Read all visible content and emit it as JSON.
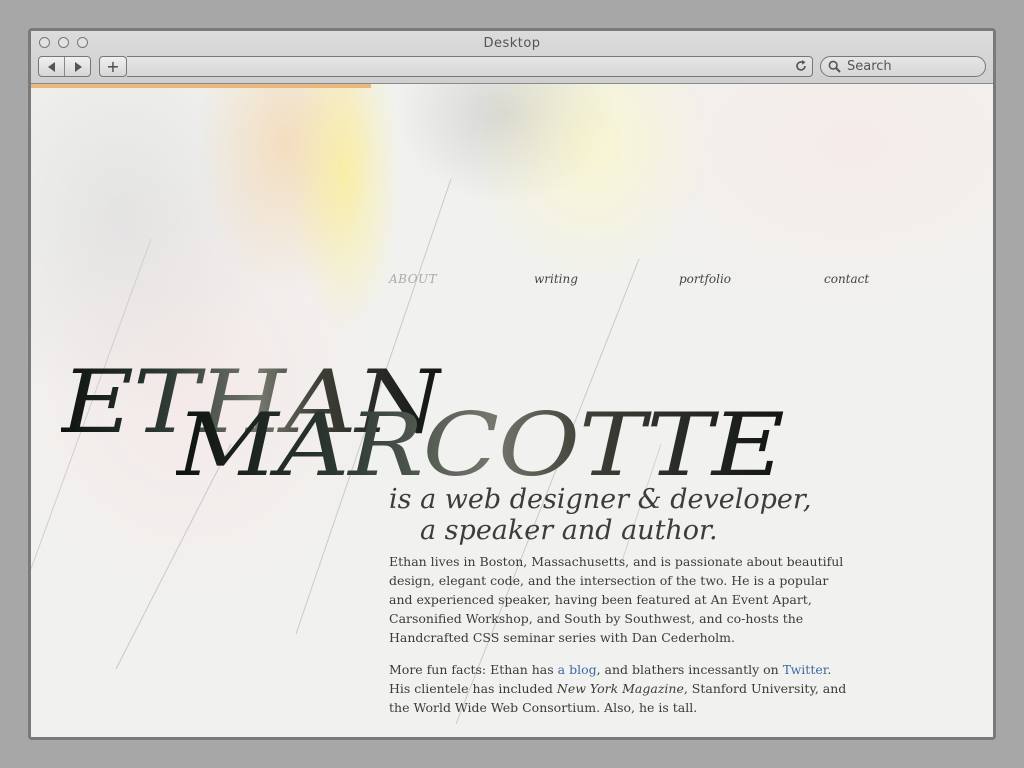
{
  "window": {
    "title": "Desktop",
    "search_placeholder": "Search",
    "nav_back_icon": "back-arrow-icon",
    "nav_forward_icon": "forward-arrow-icon",
    "new_tab_label": "+",
    "reload_icon": "reload-icon",
    "search_icon": "magnifier-icon"
  },
  "page": {
    "nav": [
      {
        "label": "ABOUT",
        "active": true
      },
      {
        "label": "writing",
        "active": false
      },
      {
        "label": "portfolio",
        "active": false
      },
      {
        "label": "contact",
        "active": false
      }
    ],
    "name_first": "ETHAN",
    "name_last": "MARCOTTE",
    "tagline_line1": "is a web designer",
    "tagline_amp": "&",
    "tagline_line1b": "developer,",
    "tagline_line2": "a speaker and author.",
    "bio": {
      "p1": "Ethan lives in Boston, Massachusetts, and is passionate about beautiful design, elegant code, and the intersection of the two. He is a popular and experienced speaker, having been featured at An Event Apart, Carsonified Workshop, and South by Southwest, and co-hosts the Handcrafted CSS seminar series with Dan Cederholm.",
      "p2_a": "More fun facts: Ethan has ",
      "p2_link1": "a blog",
      "p2_b": ", and blathers incessantly on ",
      "p2_link2": "Twitter",
      "p2_c": ". His clientele has included ",
      "p2_em": "New York Magazine",
      "p2_d": ", Stanford University, and the World Wide Web Consortium. Also, he is tall."
    },
    "colors": {
      "link": "#3b6aa5",
      "progress": "#e9b981",
      "background": "#f1f1ef"
    }
  }
}
